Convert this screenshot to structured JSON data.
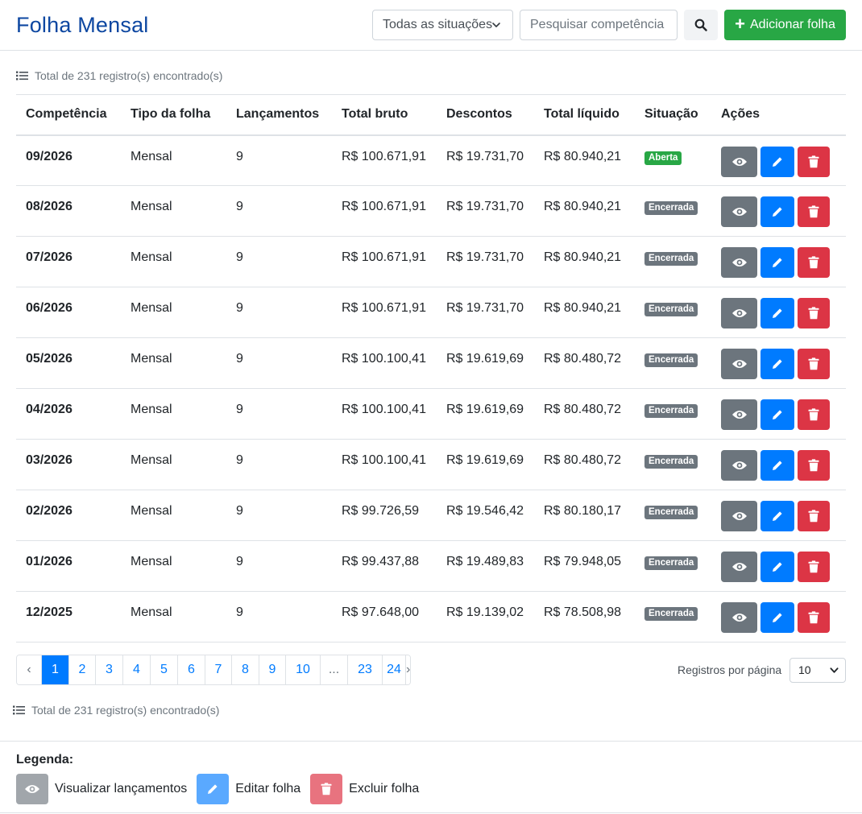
{
  "header": {
    "title": "Folha Mensal",
    "status_filter": "Todas as situações",
    "search_placeholder": "Pesquisar competência",
    "add_label": "Adicionar folha",
    "colors": {
      "title": "#0d47a1",
      "add": "#28a745"
    }
  },
  "total_text": "Total de 231 registro(s) encontrado(s)",
  "table": {
    "columns": [
      "Competência",
      "Tipo da folha",
      "Lançamentos",
      "Total bruto",
      "Descontos",
      "Total líquido",
      "Situação",
      "Ações"
    ],
    "rows": [
      {
        "competencia": "09/2026",
        "tipo": "Mensal",
        "lancamentos": "9",
        "bruto": "R$ 100.671,91",
        "descontos": "R$ 19.731,70",
        "liquido": "R$ 80.940,21",
        "situacao": "Aberta",
        "status": "open"
      },
      {
        "competencia": "08/2026",
        "tipo": "Mensal",
        "lancamentos": "9",
        "bruto": "R$ 100.671,91",
        "descontos": "R$ 19.731,70",
        "liquido": "R$ 80.940,21",
        "situacao": "Encerrada",
        "status": "closed"
      },
      {
        "competencia": "07/2026",
        "tipo": "Mensal",
        "lancamentos": "9",
        "bruto": "R$ 100.671,91",
        "descontos": "R$ 19.731,70",
        "liquido": "R$ 80.940,21",
        "situacao": "Encerrada",
        "status": "closed"
      },
      {
        "competencia": "06/2026",
        "tipo": "Mensal",
        "lancamentos": "9",
        "bruto": "R$ 100.671,91",
        "descontos": "R$ 19.731,70",
        "liquido": "R$ 80.940,21",
        "situacao": "Encerrada",
        "status": "closed"
      },
      {
        "competencia": "05/2026",
        "tipo": "Mensal",
        "lancamentos": "9",
        "bruto": "R$ 100.100,41",
        "descontos": "R$ 19.619,69",
        "liquido": "R$ 80.480,72",
        "situacao": "Encerrada",
        "status": "closed"
      },
      {
        "competencia": "04/2026",
        "tipo": "Mensal",
        "lancamentos": "9",
        "bruto": "R$ 100.100,41",
        "descontos": "R$ 19.619,69",
        "liquido": "R$ 80.480,72",
        "situacao": "Encerrada",
        "status": "closed"
      },
      {
        "competencia": "03/2026",
        "tipo": "Mensal",
        "lancamentos": "9",
        "bruto": "R$ 100.100,41",
        "descontos": "R$ 19.619,69",
        "liquido": "R$ 80.480,72",
        "situacao": "Encerrada",
        "status": "closed"
      },
      {
        "competencia": "02/2026",
        "tipo": "Mensal",
        "lancamentos": "9",
        "bruto": "R$ 99.726,59",
        "descontos": "R$ 19.546,42",
        "liquido": "R$ 80.180,17",
        "situacao": "Encerrada",
        "status": "closed"
      },
      {
        "competencia": "01/2026",
        "tipo": "Mensal",
        "lancamentos": "9",
        "bruto": "R$ 99.437,88",
        "descontos": "R$ 19.489,83",
        "liquido": "R$ 79.948,05",
        "situacao": "Encerrada",
        "status": "closed"
      },
      {
        "competencia": "12/2025",
        "tipo": "Mensal",
        "lancamentos": "9",
        "bruto": "R$ 97.648,00",
        "descontos": "R$ 19.139,02",
        "liquido": "R$ 78.508,98",
        "situacao": "Encerrada",
        "status": "closed"
      }
    ],
    "actions": [
      {
        "name": "view",
        "icon": "eye-icon",
        "color": "#6c757d"
      },
      {
        "name": "edit",
        "icon": "pencil-icon",
        "color": "#007bff"
      },
      {
        "name": "delete",
        "icon": "trash-icon",
        "color": "#dc3545"
      }
    ],
    "status_colors": {
      "open": "#28a745",
      "closed": "#6c757d"
    }
  },
  "pagination": {
    "prev": "‹",
    "pages": [
      "1",
      "2",
      "3",
      "4",
      "5",
      "6",
      "7",
      "8",
      "9",
      "10",
      "...",
      "23",
      "24"
    ],
    "active": "1",
    "next": "›",
    "per_page_label": "Registros por página",
    "per_page_value": "10"
  },
  "legend": {
    "title": "Legenda:",
    "items": [
      {
        "icon": "eye-icon",
        "label": "Visualizar lançamentos"
      },
      {
        "icon": "pencil-icon",
        "label": "Editar folha"
      },
      {
        "icon": "trash-icon",
        "label": "Excluir folha"
      }
    ]
  }
}
